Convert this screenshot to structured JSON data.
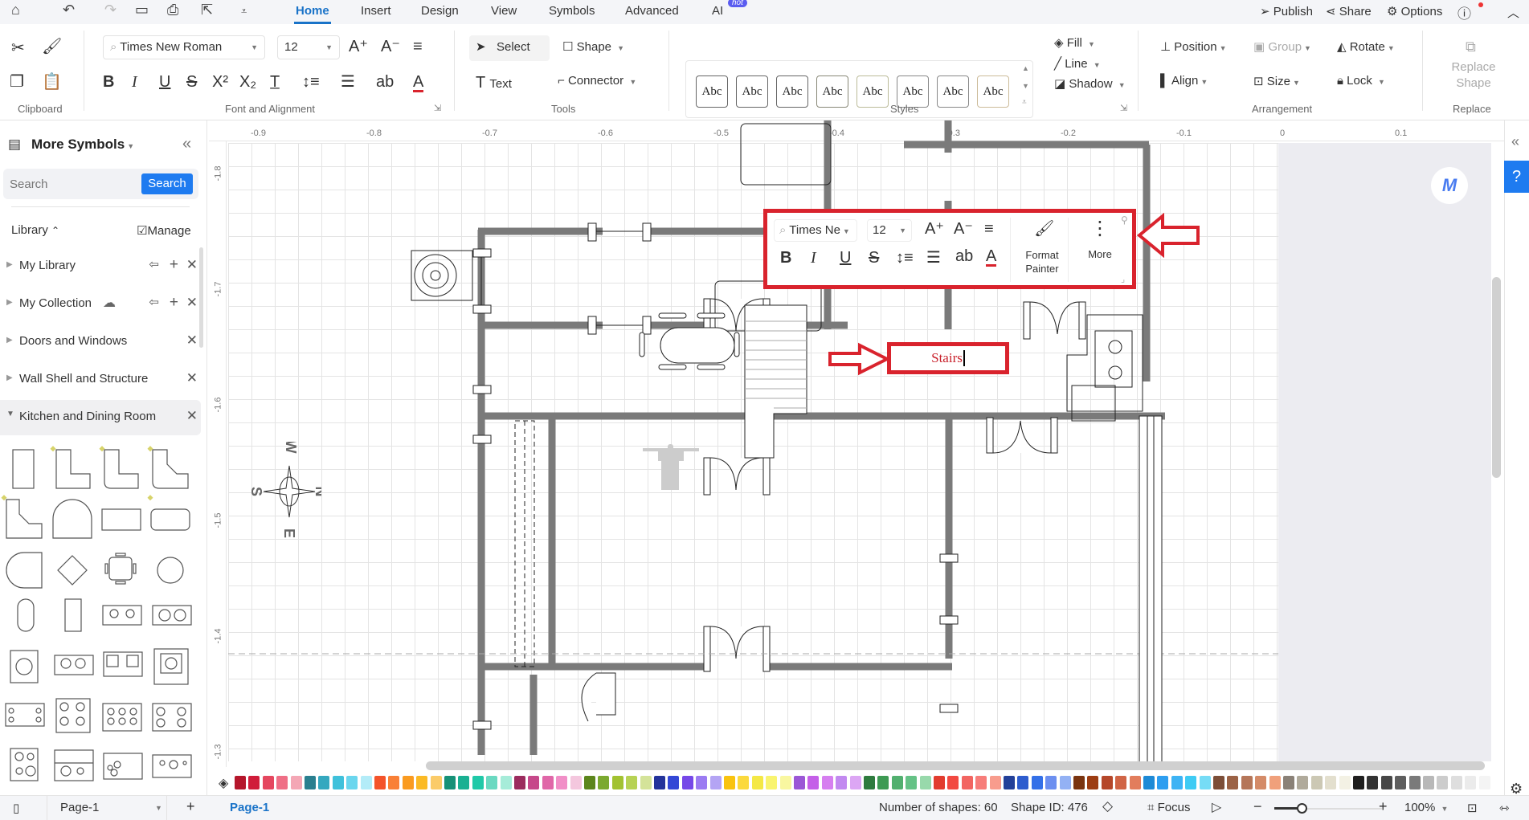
{
  "menubar": {
    "tabs": [
      "Home",
      "Insert",
      "Design",
      "View",
      "Symbols",
      "Advanced",
      "AI"
    ],
    "active_tab": "Home",
    "ai_badge": "hot",
    "right": {
      "publish": "Publish",
      "share": "Share",
      "options": "Options"
    }
  },
  "ribbon": {
    "clipboard": {
      "label": "Clipboard"
    },
    "font": {
      "family": "Times New Roman",
      "size": "12",
      "label": "Font and Alignment"
    },
    "tools": {
      "select": "Select",
      "shape": "Shape",
      "text": "Text",
      "connector": "Connector",
      "label": "Tools"
    },
    "styles": {
      "items": [
        "Abc",
        "Abc",
        "Abc",
        "Abc",
        "Abc",
        "Abc",
        "Abc",
        "Abc"
      ],
      "label": "Styles"
    },
    "format": {
      "fill": "Fill",
      "line": "Line",
      "shadow": "Shadow"
    },
    "arrangement": {
      "position": "Position",
      "group": "Group",
      "rotate": "Rotate",
      "align": "Align",
      "size": "Size",
      "lock": "Lock",
      "label": "Arrangement"
    },
    "replace": {
      "button": "Replace Shape",
      "label": "Replace"
    }
  },
  "left_panel": {
    "title": "More Symbols",
    "search_placeholder": "Search",
    "search_button": "Search",
    "library_label": "Library",
    "manage_label": "Manage",
    "libraries": [
      {
        "name": "My Library",
        "expanded": false
      },
      {
        "name": "My Collection",
        "expanded": false
      },
      {
        "name": "Doors and Windows",
        "expanded": false
      },
      {
        "name": "Wall Shell and Structure",
        "expanded": false
      },
      {
        "name": "Kitchen and Dining Room",
        "expanded": true
      }
    ]
  },
  "canvas": {
    "hruler_ticks": [
      "-0.9",
      "-0.8",
      "-0.7",
      "-0.6",
      "-0.5",
      "-0.4",
      "-0.3",
      "-0.2",
      "-0.1",
      "0",
      "0.1"
    ],
    "vruler_ticks": [
      "-1.8",
      "-1.7",
      "-1.6",
      "-1.5",
      "-1.4",
      "-1.3"
    ],
    "compass": {
      "n": "N",
      "s": "S",
      "e": "E",
      "w": "W"
    },
    "text_box": "Stairs"
  },
  "floating_toolbar": {
    "font": "Times Ne",
    "size": "12",
    "format_painter": "Format Painter",
    "more": "More"
  },
  "palette": [
    "#b5162b",
    "#d01c3a",
    "#e5475f",
    "#ef6f86",
    "#f4a7b5",
    "#2a7f8f",
    "#35a8bf",
    "#3fc1db",
    "#6ad6ee",
    "#b3ecf8",
    "#f4532a",
    "#f98036",
    "#fa9b20",
    "#fbba25",
    "#fbcb68",
    "#169177",
    "#19b092",
    "#20c9a8",
    "#6ad9c1",
    "#a6ecd9",
    "#9b2c5e",
    "#c6488a",
    "#e067a8",
    "#f18fc7",
    "#f4c7de",
    "#5c861c",
    "#7ba930",
    "#a2c231",
    "#b7d254",
    "#d4e399",
    "#23339b",
    "#3347d6",
    "#7648e8",
    "#9b7bf2",
    "#b4a4f4",
    "#f9c30f",
    "#fbd93c",
    "#f4e845",
    "#f9f46f",
    "#f9f7a0",
    "#9b57d6",
    "#c45fe8",
    "#d67ff0",
    "#c289f0",
    "#dca6f4",
    "#2e7b3e",
    "#3d9a53",
    "#52b06f",
    "#65c286",
    "#98d9ab",
    "#e23c2e",
    "#f24941",
    "#f26561",
    "#f77d7a",
    "#f89c8d",
    "#234099",
    "#2d5cce",
    "#3470e8",
    "#6c8ff0",
    "#93b1f4",
    "#7a3410",
    "#9d3d12",
    "#b5472a",
    "#d06445",
    "#e27d5c",
    "#1e8ad6",
    "#2d9ef0",
    "#3db3f4",
    "#3ecbf4",
    "#76dcf6",
    "#7c4e38",
    "#9b6245",
    "#b57659",
    "#d48b68",
    "#f0a07b",
    "#8a8177",
    "#b0aa9b",
    "#ccc8b4",
    "#e3dfce",
    "#f3f1e4",
    "#1f1f1f",
    "#333333",
    "#474747",
    "#5e5e5e",
    "#7a7a7a",
    "#b8b8b8",
    "#cccccc",
    "#dedede",
    "#ebebeb",
    "#f4f4f4"
  ],
  "statusbar": {
    "page_select": "Page-1",
    "page_tab": "Page-1",
    "shape_count": "Number of shapes: 60",
    "shape_id": "Shape ID: 476",
    "focus": "Focus",
    "zoom": "100%",
    "zoom_fraction": 0.25
  },
  "colors": {
    "accent": "#1a73c8",
    "annotation_red": "#d9232d",
    "wall": "#7a7a7a"
  }
}
